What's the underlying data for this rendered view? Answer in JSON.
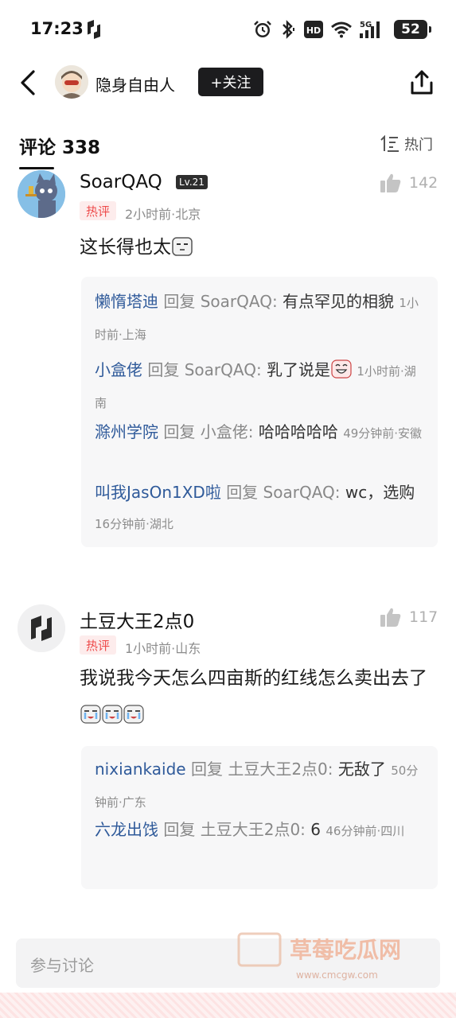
{
  "status_bar": {
    "time": "17:23",
    "battery": "52",
    "icons": [
      "alarm-icon",
      "bluetooth-icon",
      "hd-icon",
      "wifi-icon",
      "signal-5g-icon",
      "battery-icon"
    ]
  },
  "header": {
    "user_name": "隐身自由人",
    "follow_label": "+关注"
  },
  "comments_section": {
    "title": "评论 338",
    "sort_label": "热门"
  },
  "comments": [
    {
      "name": "SoarQAQ",
      "level": "Lv.21",
      "likes": "142",
      "tag": "热评",
      "meta": "2小时前·北京",
      "text": "这长得也太",
      "replies": [
        {
          "name": "懒惰塔迪",
          "reply_word": "回复",
          "target": "SoarQAQ:",
          "text": "有点罕见的相貌",
          "meta": "1小时前·上海"
        },
        {
          "name": "小盒佬",
          "reply_word": "回复",
          "target": "SoarQAQ:",
          "text": "乳了说是",
          "meta": "1小时前·湖南"
        },
        {
          "name": "滁州学院",
          "reply_word": "回复",
          "target": "小盒佬:",
          "text": "哈哈哈哈哈",
          "meta": "49分钟前·安徽"
        },
        {
          "name": "叫我JasOn1XD啦",
          "reply_word": "回复",
          "target": "SoarQAQ:",
          "text": "wc，选购",
          "meta": "16分钟前·湖北"
        }
      ]
    },
    {
      "name": "土豆大王2点0",
      "likes": "117",
      "tag": "热评",
      "meta": "1小时前·山东",
      "text": "我说我今天怎么四亩斯的红线怎么卖出去了",
      "replies": [
        {
          "name": "nixiankaide",
          "reply_word": "回复",
          "target": "土豆大王2点0:",
          "text": "无敌了",
          "meta": "50分钟前·广东"
        },
        {
          "name": "六龙出饯",
          "reply_word": "回复",
          "target": "土豆大王2点0:",
          "text": "6",
          "meta": "46分钟前·四川"
        }
      ]
    }
  ],
  "bottom_bar": {
    "placeholder": "参与讨论"
  },
  "watermark": {
    "text": "草莓吃瓜网",
    "url": "www.cmcgw.com"
  }
}
